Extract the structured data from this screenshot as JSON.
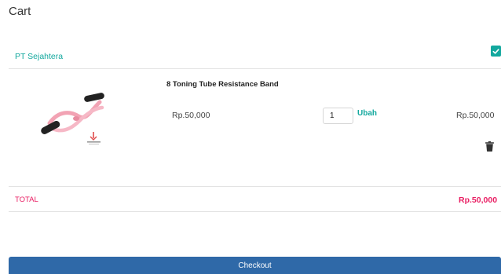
{
  "page": {
    "title": "Cart"
  },
  "seller": {
    "name": "PT Sejahtera"
  },
  "item": {
    "name": "8 Toning Tube Resistance Band",
    "unit_price": "Rp.50,000",
    "quantity": "1",
    "update_label": "Ubah",
    "line_total": "Rp.50,000",
    "image_icon": "resistance-band-image",
    "delete_icon": "trash-icon"
  },
  "summary": {
    "total_label": "TOTAL",
    "total_value": "Rp.50,000"
  },
  "checkout": {
    "label": "Checkout"
  },
  "colors": {
    "accent": "#13a89e",
    "total": "#e91e63",
    "button": "#2f69a8"
  }
}
